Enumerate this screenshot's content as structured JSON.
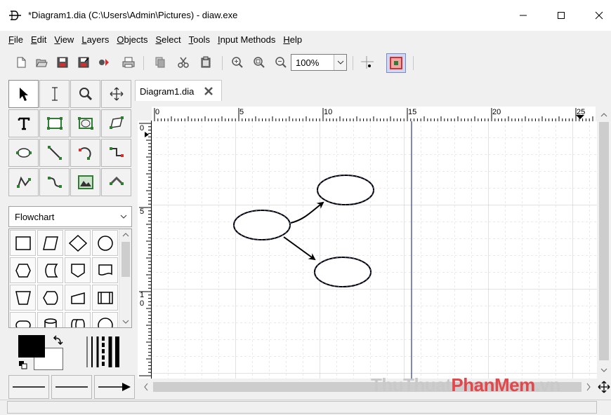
{
  "window": {
    "title": "*Diagram1.dia (C:\\Users\\Admin\\Pictures) - diaw.exe"
  },
  "menu": [
    {
      "u": "F",
      "rest": "ile"
    },
    {
      "u": "E",
      "rest": "dit"
    },
    {
      "u": "V",
      "rest": "iew"
    },
    {
      "u": "L",
      "rest": "ayers"
    },
    {
      "u": "O",
      "rest": "bjects"
    },
    {
      "u": "S",
      "rest": "elect"
    },
    {
      "u": "T",
      "rest": "ools"
    },
    {
      "u": "I",
      "rest": "nput Methods"
    },
    {
      "u": "H",
      "rest": "elp"
    }
  ],
  "toolbar": {
    "zoom": "100%"
  },
  "sheet": {
    "selected": "Flowchart"
  },
  "tabs": [
    {
      "label": "Diagram1.dia"
    }
  ],
  "ruler": {
    "top_labels": [
      "0",
      "5",
      "10",
      "15",
      "20",
      "25"
    ],
    "left_labels": [
      "0",
      "5",
      "1",
      "0"
    ]
  },
  "colors": {
    "accent_red": "#d32f2f",
    "shape_green": "#2e7d32",
    "grid": "#cfcfcf",
    "guide": "#2b3a8a"
  },
  "watermark": {
    "part1": "ThuThuat",
    "part2": "PhanMem",
    "part3": ".vn"
  }
}
